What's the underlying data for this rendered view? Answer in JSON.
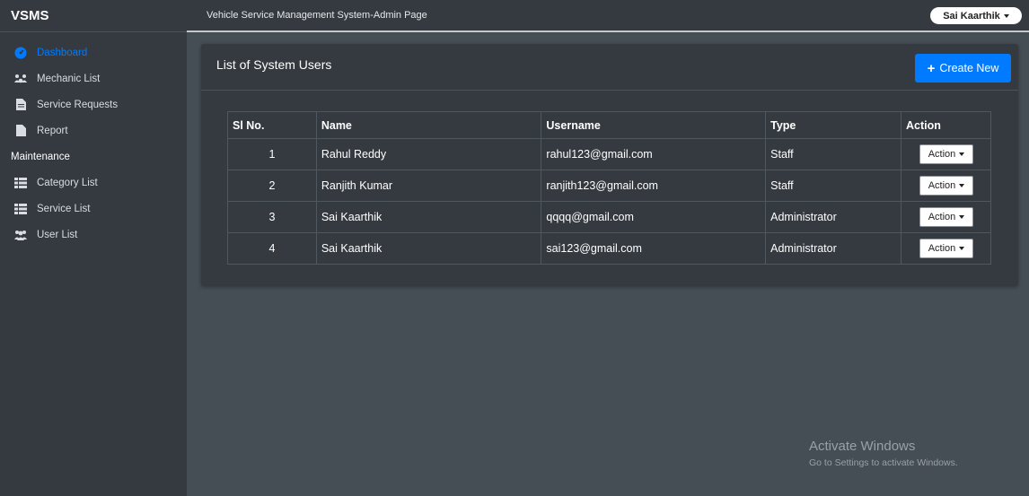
{
  "app": {
    "brand": "VSMS",
    "page_title": "Vehicle Service Management System-Admin Page"
  },
  "user_menu": {
    "label": "Sai Kaarthik"
  },
  "sidebar": {
    "items": [
      {
        "label": "Dashboard",
        "icon": "dashboard-icon"
      },
      {
        "label": "Mechanic List",
        "icon": "users-gear-icon"
      },
      {
        "label": "Service Requests",
        "icon": "file-list-icon"
      },
      {
        "label": "Report",
        "icon": "file-icon"
      }
    ],
    "section_header": "Maintenance",
    "maintenance_items": [
      {
        "label": "Category List",
        "icon": "table-list-icon"
      },
      {
        "label": "Service List",
        "icon": "table-list-icon"
      },
      {
        "label": "User List",
        "icon": "users-icon"
      }
    ]
  },
  "card": {
    "title": "List of System Users",
    "create_label": "Create New"
  },
  "table": {
    "headers": [
      "Sl No.",
      "Name",
      "Username",
      "Type",
      "Action"
    ],
    "rows": [
      {
        "sl": "1",
        "name": "Rahul Reddy",
        "username": "rahul123@gmail.com",
        "type": "Staff",
        "action": "Action"
      },
      {
        "sl": "2",
        "name": "Ranjith Kumar",
        "username": "ranjith123@gmail.com",
        "type": "Staff",
        "action": "Action"
      },
      {
        "sl": "3",
        "name": "Sai Kaarthik",
        "username": "qqqq@gmail.com",
        "type": "Administrator",
        "action": "Action"
      },
      {
        "sl": "4",
        "name": "Sai Kaarthik",
        "username": "sai123@gmail.com",
        "type": "Administrator",
        "action": "Action"
      }
    ]
  },
  "watermark": {
    "line1": "Activate Windows",
    "line2": "Go to Settings to activate Windows."
  },
  "colors": {
    "accent": "#007bff",
    "sidebar_bg": "#343a40",
    "content_bg": "#454d55"
  }
}
